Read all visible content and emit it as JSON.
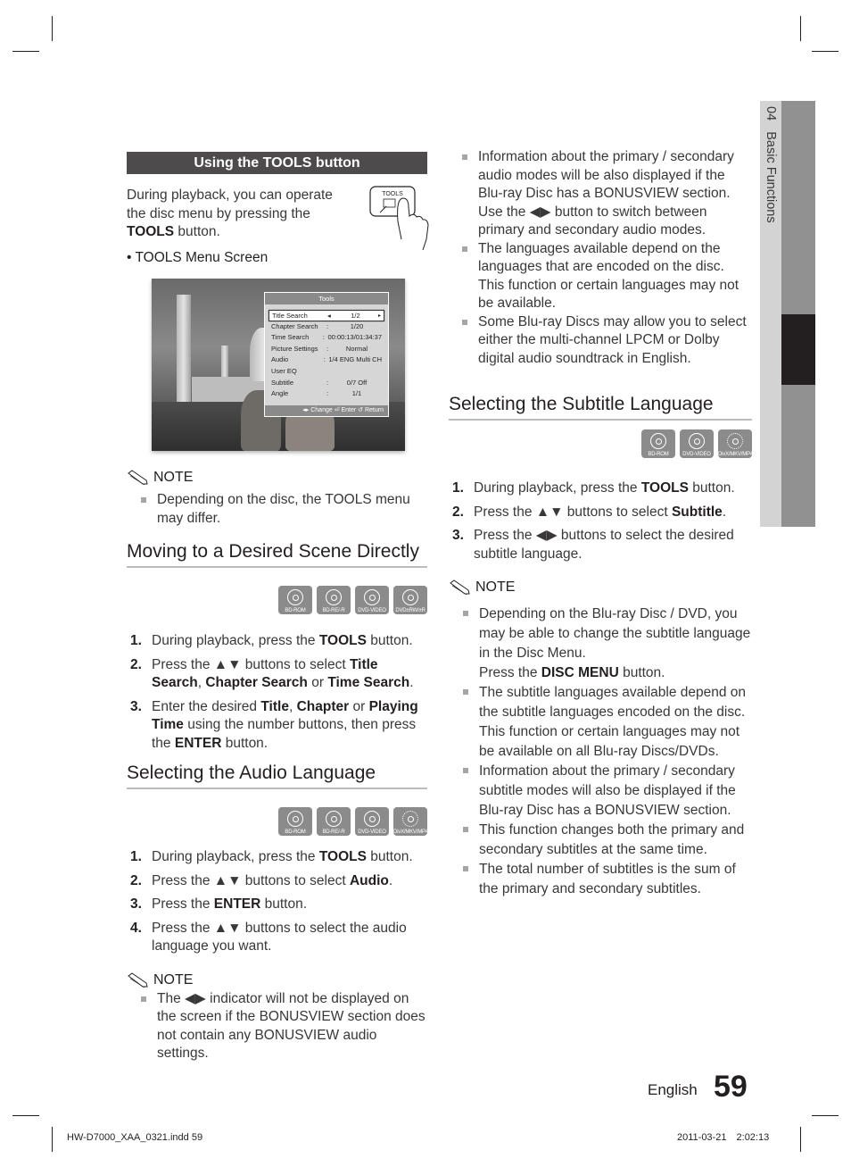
{
  "side_tab": {
    "chapter": "04",
    "label": "Basic Functions"
  },
  "tools_section": {
    "title": "Using the TOOLS button",
    "intro_pre": "During playback, you can operate the disc menu by pressing the ",
    "intro_bold": "TOOLS",
    "intro_post": " button.",
    "remote_button_label": "TOOLS",
    "bullet_label": "TOOLS Menu Screen",
    "menu": {
      "title": "Tools",
      "rows": [
        {
          "key": "Title Search",
          "sep": "◂",
          "value": "1/2",
          "right": "▸",
          "selected": true
        },
        {
          "key": "Chapter Search",
          "sep": ":",
          "value": "1/20"
        },
        {
          "key": "Time Search",
          "sep": ":",
          "value": "00:00:13/01:34:37"
        },
        {
          "key": "Picture Settings",
          "sep": ":",
          "value": "Normal"
        },
        {
          "key": "Audio",
          "sep": ":",
          "value": "1/4 ENG Multi CH"
        },
        {
          "key": "User EQ",
          "sep": "",
          "value": ""
        },
        {
          "key": "Subtitle",
          "sep": ":",
          "value": "0/7 Off"
        },
        {
          "key": "Angle",
          "sep": ":",
          "value": "1/1"
        }
      ],
      "footer": "◂▸ Change   ⏎ Enter   ↺ Return"
    },
    "note_label": "NOTE",
    "notes": [
      "Depending on the disc, the TOOLS menu may differ."
    ]
  },
  "scene_section": {
    "title": "Moving to a Desired Scene Directly",
    "icons": [
      "BD-ROM",
      "BD-RE/-R",
      "DVD-VIDEO",
      "DVD±RW/±R"
    ],
    "steps": [
      {
        "num": "1.",
        "parts": [
          "During playback, press the ",
          "*TOOLS",
          " button."
        ]
      },
      {
        "num": "2.",
        "parts": [
          "Press the ▲▼ buttons to select ",
          "*Title Search",
          ", ",
          "*Chapter Search",
          " or ",
          "*Time Search",
          "."
        ]
      },
      {
        "num": "3.",
        "parts": [
          "Enter the desired ",
          "*Title",
          ", ",
          "*Chapter",
          " or ",
          "*Playing Time",
          " using the number buttons, then press the ",
          "*ENTER",
          " button."
        ]
      }
    ]
  },
  "audio_section": {
    "title": "Selecting the Audio Language",
    "icons": [
      "BD-ROM",
      "BD-RE/-R",
      "DVD-VIDEO",
      "DivX/MKV/MP4"
    ],
    "steps": [
      {
        "num": "1.",
        "parts": [
          "During playback, press the ",
          "*TOOLS",
          " button."
        ]
      },
      {
        "num": "2.",
        "parts": [
          "Press the ▲▼ buttons to select ",
          "*Audio",
          "."
        ]
      },
      {
        "num": "3.",
        "parts": [
          "Press the ",
          "*ENTER",
          " button."
        ]
      },
      {
        "num": "4.",
        "parts": [
          "Press the ▲▼ buttons to select the audio language you want."
        ]
      }
    ],
    "note_label": "NOTE",
    "notes": [
      [
        "The ◀▶ indicator will not be displayed on the screen if the BONUSVIEW section does not contain any BONUSVIEW audio settings."
      ],
      [
        "Information about the primary / secondary audio modes will be also displayed if the Blu-ray Disc has a BONUSVIEW section.\nUse the ◀▶ button to switch between primary and secondary audio modes."
      ],
      [
        "The languages available depend on the languages that are encoded on the disc. This function or certain languages may not be available."
      ],
      [
        "Some Blu-ray Discs may allow you to select either the multi-channel LPCM or Dolby digital audio soundtrack in English."
      ]
    ]
  },
  "subtitle_section": {
    "title": "Selecting the Subtitle Language",
    "icons": [
      "BD-ROM",
      "DVD-VIDEO",
      "DivX/MKV/MP4"
    ],
    "steps": [
      {
        "num": "1.",
        "parts": [
          "During playback, press the ",
          "*TOOLS",
          " button."
        ]
      },
      {
        "num": "2.",
        "parts": [
          "Press the ▲▼ buttons to select ",
          "*Subtitle",
          "."
        ]
      },
      {
        "num": "3.",
        "parts": [
          "Press the ◀▶ buttons to select the desired subtitle language."
        ]
      }
    ],
    "note_label": "NOTE",
    "notes": [
      [
        "Depending on the Blu-ray Disc / DVD, you may be able to change the subtitle language in the Disc Menu.\nPress the ",
        "*DISC MENU",
        " button."
      ],
      [
        "The subtitle languages available depend on the subtitle languages encoded on the disc. This function or certain languages may not be available on all Blu-ray Discs/DVDs."
      ],
      [
        "Information about the primary / secondary subtitle modes will also be displayed if the Blu-ray Disc has a BONUSVIEW section."
      ],
      [
        "This function changes both the primary and secondary subtitles at the same time."
      ],
      [
        "The total number of subtitles is the sum of the primary and secondary subtitles."
      ]
    ]
  },
  "footer": {
    "language": "English",
    "page_number": "59",
    "slug_file": "HW-D7000_XAA_0321.indd   59",
    "slug_date": "2011-03-21",
    "slug_time": "2:02:13"
  }
}
